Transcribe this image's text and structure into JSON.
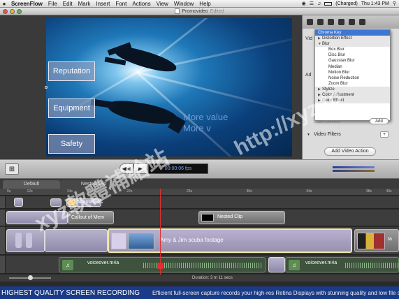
{
  "menubar": {
    "app": "ScreenFlow",
    "items": [
      "File",
      "Edit",
      "Mark",
      "Insert",
      "Font",
      "Actions",
      "View",
      "Window",
      "Help"
    ],
    "status": "(Charged)",
    "clock": "Thu 1:43 PM"
  },
  "window": {
    "title": "Promovideo",
    "state": "Edited"
  },
  "canvas": {
    "buttons": [
      "Reputation",
      "Equipment",
      "Safety"
    ],
    "caption_line1": "More value",
    "caption_line2": "More v"
  },
  "inspector": {
    "side_label_1": "Vid",
    "side_label_2": "Ad",
    "filter_menu": [
      {
        "label": "Chroma Key",
        "kind": "item",
        "selected": true
      },
      {
        "label": "Distortion Effect",
        "kind": "category"
      },
      {
        "label": "Blur",
        "kind": "category"
      },
      {
        "label": "Box Blur",
        "kind": "sub"
      },
      {
        "label": "Disc Blur",
        "kind": "sub"
      },
      {
        "label": "Gaussian Blur",
        "kind": "sub"
      },
      {
        "label": "Median",
        "kind": "sub"
      },
      {
        "label": "Motion Blur",
        "kind": "sub"
      },
      {
        "label": "Noise Reduction",
        "kind": "sub"
      },
      {
        "label": "Zoom Blur",
        "kind": "sub"
      },
      {
        "label": "Stylize",
        "kind": "category"
      },
      {
        "label": "Color Adjustment",
        "kind": "category"
      },
      {
        "label": "Color Effect",
        "kind": "category"
      }
    ],
    "color_controls": "Color Controls",
    "add_label": "Add",
    "video_filters_label": "Video Filters",
    "plus_label": "+",
    "add_video_action": "Add Video Action"
  },
  "transport": {
    "rewind": "◀◀",
    "play": "▶",
    "time": "00:00:06 fps"
  },
  "timeline": {
    "tabs": [
      "Default",
      "Nested Clip"
    ],
    "ruler_ticks": [
      "0s",
      "12s",
      "",
      "14s",
      "",
      "",
      "22s",
      "",
      "",
      "26s",
      "",
      "",
      "30s",
      "",
      "",
      "34s",
      "",
      "",
      "38s",
      "40s"
    ],
    "clips": {
      "annotations": "Annotations",
      "callout": "Callout of Mem",
      "nested_clip": "Nested Clip",
      "scuba": "Amy & Jim scuba footage",
      "voiceover_left": "voiceover.m4a",
      "voiceover_right": "voiceover.m4a",
      "end_clip": "ta"
    },
    "duration": "Duration: 3 m 11 secs"
  },
  "caption": {
    "main": "HIGHEST QUALITY SCREEN RECORDING",
    "sub": "Efficient full-screen capture records your high-res Retina Displays with stunning quality and low file sizes"
  },
  "watermark": {
    "chinese": "xyz軟體補給站",
    "url": "http://xyz.to"
  },
  "colors": {
    "selection": "#3e76d3",
    "caption_bar": "#1a3b88",
    "playhead": "#e03030",
    "canvas_text": "#6d9ad6"
  }
}
